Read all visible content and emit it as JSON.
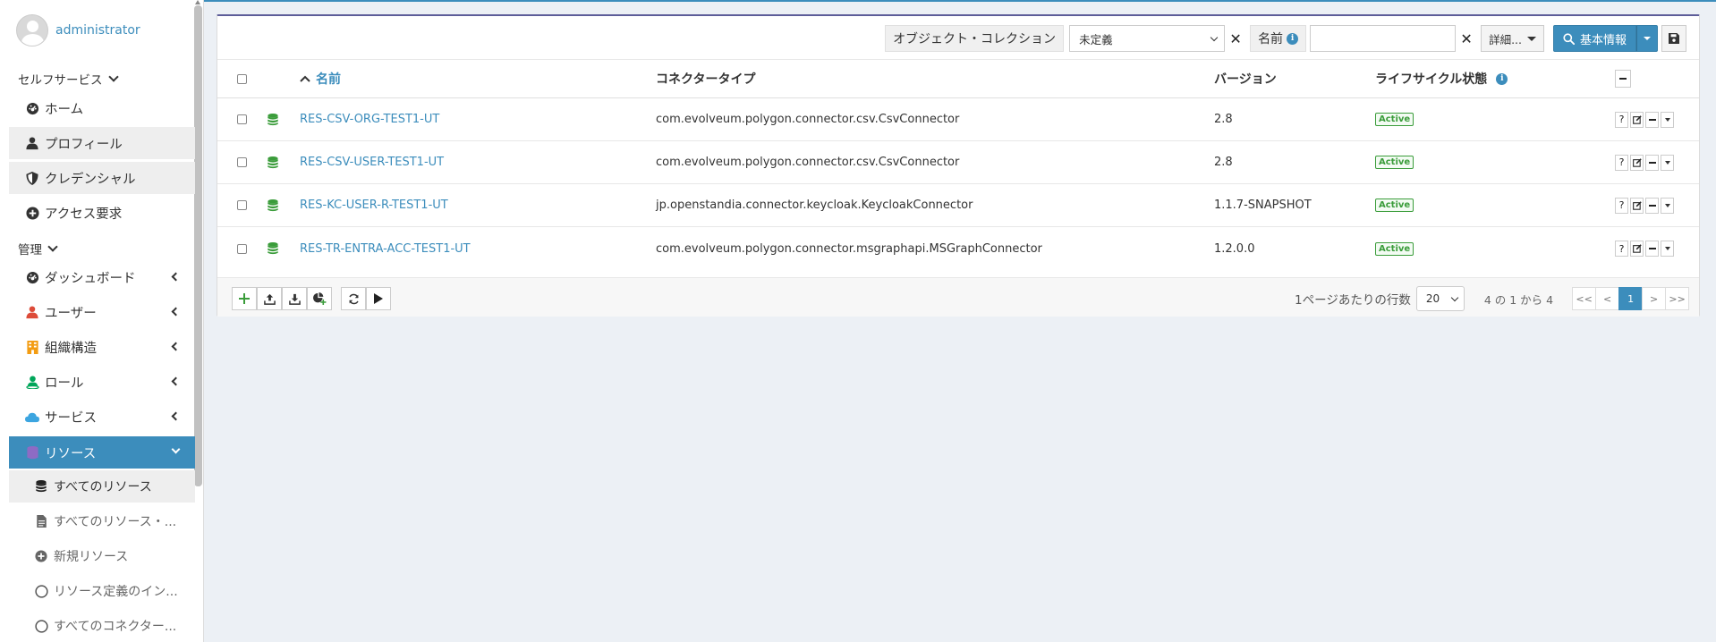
{
  "user": {
    "name": "administrator"
  },
  "sidebar": {
    "self_service_header": "セルフサービス",
    "admin_header": "管理",
    "self_items": [
      {
        "label": "ホーム",
        "icon": "dashboard-icon"
      },
      {
        "label": "プロフィール",
        "icon": "user-icon"
      },
      {
        "label": "クレデンシャル",
        "icon": "shield-icon"
      },
      {
        "label": "アクセス要求",
        "icon": "plus-circle-icon"
      }
    ],
    "admin_items": [
      {
        "label": "ダッシュボード",
        "icon": "dashboard-icon"
      },
      {
        "label": "ユーザー",
        "icon": "user-icon",
        "color": "#dd4b39"
      },
      {
        "label": "組織構造",
        "icon": "building-icon",
        "color": "#f39c12"
      },
      {
        "label": "ロール",
        "icon": "role-icon",
        "color": "#00a65a"
      },
      {
        "label": "サービス",
        "icon": "cloud-icon",
        "color": "#3c8dbc"
      },
      {
        "label": "リソース",
        "icon": "database-icon",
        "active": true
      }
    ],
    "resource_sub_items": [
      {
        "label": "すべてのリソース",
        "icon": "database-icon"
      },
      {
        "label": "すべてのリソース・...",
        "icon": "file-icon"
      },
      {
        "label": "新規リソース",
        "icon": "plus-circle-icon"
      },
      {
        "label": "リソース定義のイン...",
        "icon": "circle-icon"
      },
      {
        "label": "すべてのコネクター...",
        "icon": "circle-icon"
      }
    ]
  },
  "toolbar": {
    "object_collection_label": "オブジェクト・コレクション",
    "object_collection_value": "未定義",
    "name_label": "名前",
    "name_value": "",
    "more_label": "詳細...",
    "basic_info_label": "基本情報"
  },
  "table": {
    "columns": {
      "name": "名前",
      "connector_type": "コネクタータイプ",
      "version": "バージョン",
      "lifecycle": "ライフサイクル状態"
    },
    "rows": [
      {
        "name": "RES-CSV-ORG-TEST1-UT",
        "connector_type": "com.evolveum.polygon.connector.csv.CsvConnector",
        "version": "2.8",
        "lifecycle": "Active"
      },
      {
        "name": "RES-CSV-USER-TEST1-UT",
        "connector_type": "com.evolveum.polygon.connector.csv.CsvConnector",
        "version": "2.8",
        "lifecycle": "Active"
      },
      {
        "name": "RES-KC-USER-R-TEST1-UT",
        "connector_type": "jp.openstandia.connector.keycloak.KeycloakConnector",
        "version": "1.1.7-SNAPSHOT",
        "lifecycle": "Active"
      },
      {
        "name": "RES-TR-ENTRA-ACC-TEST1-UT",
        "connector_type": "com.evolveum.polygon.connector.msgraphapi.MSGraphConnector",
        "version": "1.2.0.0",
        "lifecycle": "Active"
      }
    ],
    "actions": [
      "?",
      "edit",
      "-",
      "dropdown"
    ]
  },
  "footer": {
    "rows_per_page_label": "1ページあたりの行数",
    "rows_per_page_value": "20",
    "count_text": "4 の 1 から 4",
    "pager": [
      "<<",
      "<",
      "1",
      ">",
      ">>"
    ],
    "current_page": "1"
  },
  "colors": {
    "primary": "#3c8dbc",
    "active_badge": "#3a9c3a",
    "db_icon": "#3a9c3a"
  }
}
